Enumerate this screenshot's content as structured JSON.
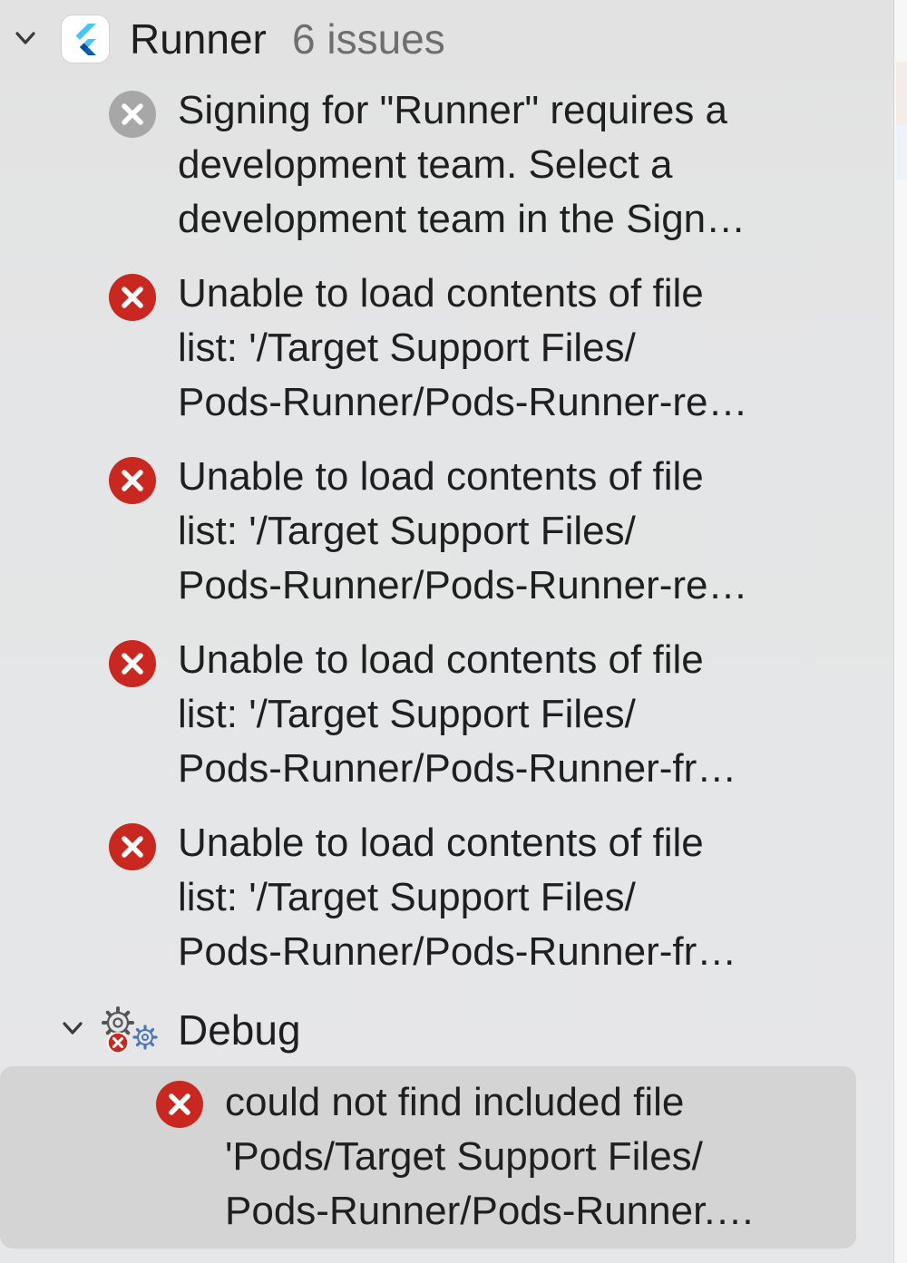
{
  "project": {
    "name": "Runner",
    "issue_count": "6 issues"
  },
  "issues": [
    {
      "severity": "warning-gray",
      "lines": [
        "Signing for \"Runner\" requires a",
        "development team. Select a",
        "development team in the Sign…"
      ]
    },
    {
      "severity": "error",
      "lines": [
        "Unable to load contents of file",
        "list: '/Target Support Files/",
        "Pods-Runner/Pods-Runner-re…"
      ]
    },
    {
      "severity": "error",
      "lines": [
        "Unable to load contents of file",
        "list: '/Target Support Files/",
        "Pods-Runner/Pods-Runner-re…"
      ]
    },
    {
      "severity": "error",
      "lines": [
        "Unable to load contents of file",
        "list: '/Target Support Files/",
        "Pods-Runner/Pods-Runner-fr…"
      ]
    },
    {
      "severity": "error",
      "lines": [
        "Unable to load contents of file",
        "list: '/Target Support Files/",
        "Pods-Runner/Pods-Runner-fr…"
      ]
    }
  ],
  "debug_group": {
    "name": "Debug",
    "icon": "gear-with-error-icon",
    "issues": [
      {
        "severity": "error",
        "selected": true,
        "lines": [
          "could not find included file",
          "'Pods/Target Support Files/",
          "Pods-Runner/Pods-Runner.…"
        ]
      }
    ]
  },
  "colors": {
    "error_red": "#c8281f",
    "gray_icon": "#a7a7a7",
    "selection": "#d4d4d5",
    "flutter_light_blue": "#47c5fb",
    "flutter_dark_blue": "#0b5ea8"
  }
}
